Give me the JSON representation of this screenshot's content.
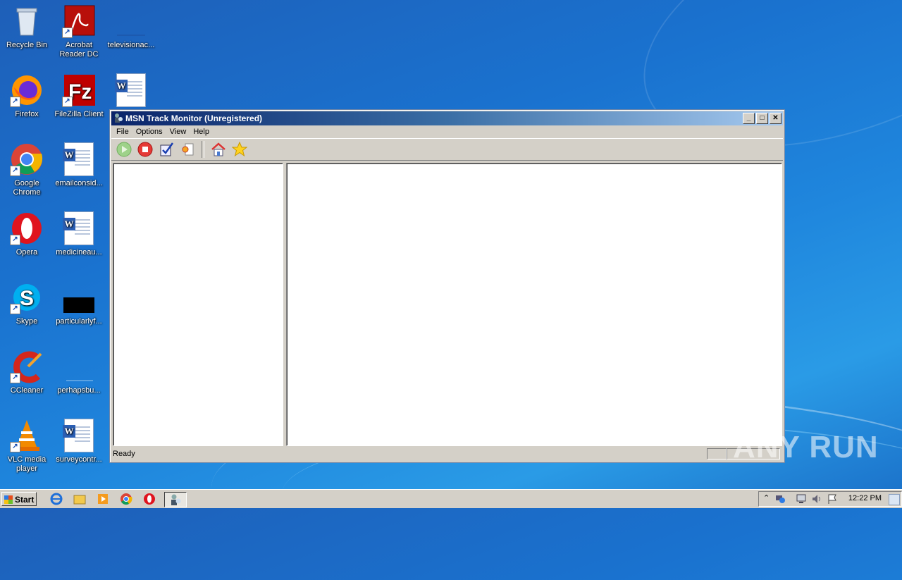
{
  "desktop": {
    "icons": [
      {
        "label": "Recycle Bin"
      },
      {
        "label": "Acrobat Reader DC"
      },
      {
        "label": "televisionac..."
      },
      {
        "label": "Firefox"
      },
      {
        "label": "FileZilla Client"
      },
      {
        "label": "Google Chrome"
      },
      {
        "label": "emailconsid..."
      },
      {
        "label": "Opera"
      },
      {
        "label": "medicineau..."
      },
      {
        "label": "Skype"
      },
      {
        "label": "particularlyf..."
      },
      {
        "label": "CCleaner"
      },
      {
        "label": "perhapsbu..."
      },
      {
        "label": "VLC media player"
      },
      {
        "label": "surveycontr..."
      }
    ]
  },
  "window": {
    "title": "MSN Track Monitor (Unregistered)",
    "menu": [
      "File",
      "Options",
      "View",
      "Help"
    ],
    "toolbar": [
      "start-icon",
      "stop-icon",
      "checklist-icon",
      "settings-icon",
      "home-icon",
      "star-icon"
    ],
    "status": "Ready"
  },
  "taskbar": {
    "start_label": "Start",
    "clock": "12:22 PM"
  },
  "watermark": "ANY RUN"
}
